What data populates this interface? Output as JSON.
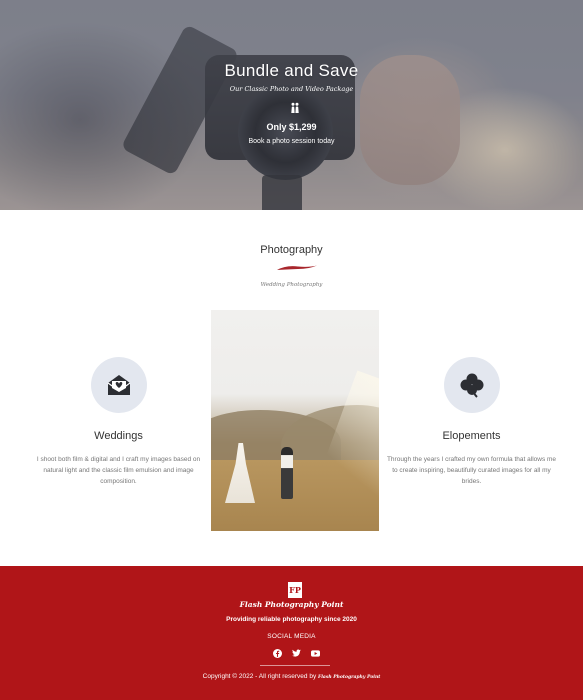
{
  "hero": {
    "title": "Bundle and Save",
    "subtitle": "Our Classic Photo and Video Package",
    "icon": "couple-icon",
    "price": "Only $1,299",
    "cta": "Book a photo session today"
  },
  "section": {
    "title": "Photography",
    "subtitle": "Wedding Photography",
    "accent_color": "#b01518",
    "features": [
      {
        "icon": "envelope-heart-icon",
        "title": "Weddings",
        "description": "I shoot both film & digital and I craft my images based on natural light and the classic film emulsion and image composition."
      },
      {
        "icon": "clover-icon",
        "title": "Elopements",
        "description": "Through the years I crafted my own formula that allows me to create inspiring, beautifully curated images for all my brides."
      }
    ]
  },
  "footer": {
    "logo_text": "FP",
    "brand": "Flash Photography Point",
    "tagline": "Providing reliable photography since 2020",
    "social_label": "SOCIAL MEDIA",
    "socials": [
      "facebook-icon",
      "twitter-icon",
      "youtube-icon"
    ],
    "copyright": "Copyright © 2022 - All right reserved by",
    "copyright_brand": "Flash Photography Point",
    "background_color": "#b01518"
  }
}
